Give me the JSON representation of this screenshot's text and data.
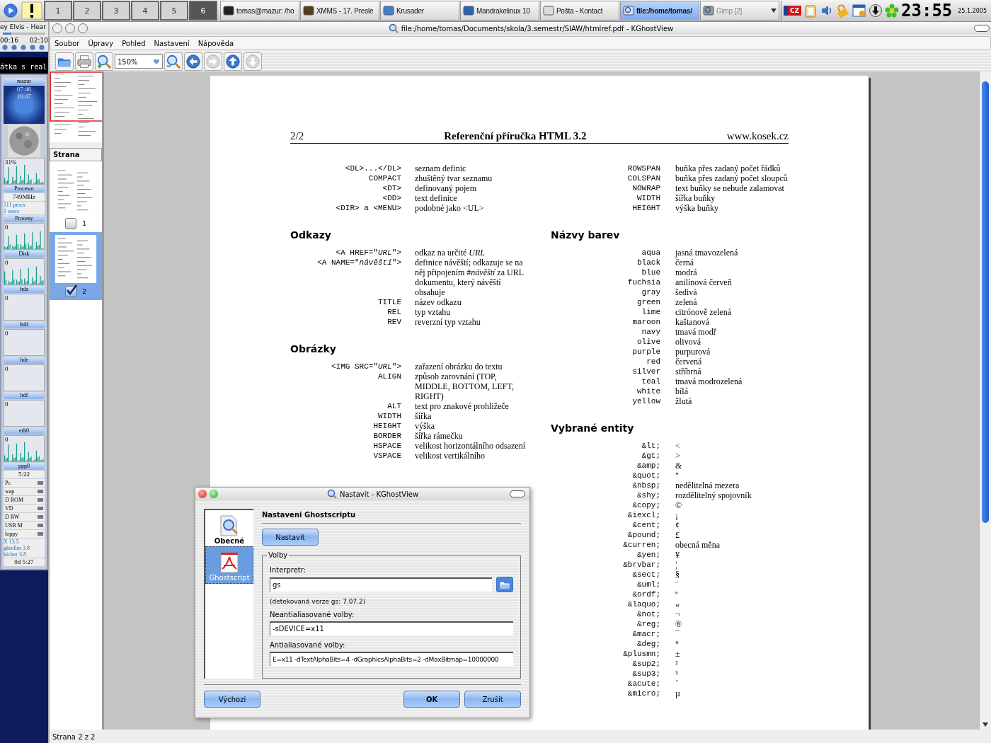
{
  "taskbar": {
    "pager": [
      {
        "label": "1",
        "selected": false
      },
      {
        "label": "2",
        "selected": false
      },
      {
        "label": "3",
        "selected": false
      },
      {
        "label": "4",
        "selected": false
      },
      {
        "label": "5",
        "selected": false
      },
      {
        "label": "6",
        "selected": true
      }
    ],
    "tasks": [
      {
        "label": "tomas@mazur: /ho",
        "active": false,
        "disabled": false
      },
      {
        "label": "XMMS - 17. Presle",
        "active": false,
        "disabled": false
      },
      {
        "label": "Krusader",
        "active": false,
        "disabled": false
      },
      {
        "label": "Mandrakelinux 10",
        "active": false,
        "disabled": false
      },
      {
        "label": "Pošta - Kontact",
        "active": false,
        "disabled": false
      },
      {
        "label": "file:/home/tomas/",
        "active": true,
        "disabled": false
      },
      {
        "label": "Gimp [2]",
        "active": false,
        "disabled": true
      }
    ],
    "keyboard_layout": "CZ",
    "clock": {
      "time": "23:55",
      "date": "25.1.2005"
    }
  },
  "gkrellm": {
    "player": {
      "ticker": "ey Elvis - Hear",
      "elapsed": "00:16",
      "total": "02:10",
      "level": 0.2
    },
    "scroller": "átka s real",
    "panels": [
      {
        "kind": "header",
        "text": "mazur"
      },
      {
        "kind": "sun",
        "times": [
          "07:46",
          "16:47"
        ]
      },
      {
        "kind": "moon"
      },
      {
        "kind": "graph",
        "value": "31%",
        "active": true
      },
      {
        "kind": "header",
        "text": "Procesor"
      },
      {
        "kind": "label",
        "text": "749MHz"
      },
      {
        "kind": "lines",
        "lines": [
          "111 procs",
          "1 users"
        ]
      },
      {
        "kind": "header",
        "text": "Procesy"
      },
      {
        "kind": "graph",
        "value": "0",
        "active": true
      },
      {
        "kind": "header",
        "text": "Disk"
      },
      {
        "kind": "graph",
        "value": "0",
        "active": true
      },
      {
        "kind": "header",
        "text": "hda"
      },
      {
        "kind": "graph",
        "value": "0",
        "active": false
      },
      {
        "kind": "header",
        "text": "hdd"
      },
      {
        "kind": "graph",
        "value": "0",
        "active": false
      },
      {
        "kind": "header",
        "text": "hde"
      },
      {
        "kind": "graph",
        "value": "0",
        "active": false
      },
      {
        "kind": "header",
        "text": "hdf"
      },
      {
        "kind": "graph",
        "value": "0",
        "active": false
      },
      {
        "kind": "header",
        "text": "eth0"
      },
      {
        "kind": "graph",
        "value": "0",
        "active": true
      },
      {
        "kind": "header",
        "text": "ppp0"
      },
      {
        "kind": "label",
        "text": "5:22"
      },
      {
        "kind": "meter",
        "text": "Pc"
      },
      {
        "kind": "meter",
        "text": "wap"
      },
      {
        "kind": "meter",
        "text": "D ROM"
      },
      {
        "kind": "meter",
        "text": "VD"
      },
      {
        "kind": "meter",
        "text": "D RW"
      },
      {
        "kind": "meter",
        "text": "USB M"
      },
      {
        "kind": "meter",
        "text": "loppy"
      },
      {
        "kind": "lines",
        "lines": [
          "X 13.5",
          "gkrellm 3.8",
          "kicker 3.8"
        ]
      },
      {
        "kind": "label",
        "text": "0d 5:27"
      }
    ]
  },
  "window": {
    "title": "file:/home/tomas/Documents/skola/3.semestr/SIAW/htmlref.pdf - KGhostView",
    "menu": [
      "Soubor",
      "Úpravy",
      "Pohled",
      "Nastavení",
      "Nápověda"
    ],
    "toolbar": [
      {
        "kind": "open"
      },
      {
        "kind": "print"
      },
      {
        "kind": "zoom-in"
      },
      {
        "kind": "zoom",
        "value": "150%"
      },
      {
        "kind": "zoom-out"
      },
      {
        "kind": "back",
        "disabled": false
      },
      {
        "kind": "forward",
        "disabled": true
      },
      {
        "kind": "up",
        "disabled": false
      },
      {
        "kind": "down",
        "disabled": true
      }
    ],
    "navigator": {
      "header": "Strana",
      "pages": [
        {
          "label": "1",
          "checked": false,
          "selected": false
        },
        {
          "label": "2",
          "checked": true,
          "selected": true
        }
      ]
    },
    "document": {
      "page_number": "2/2",
      "title": "Referenční příručka HTML 3.2",
      "site": "www.kosek.cz",
      "columns": [
        [
          {
            "rows": [
              {
                "key": "<DL>...</DL>",
                "desc": "seznam definic"
              },
              {
                "key": "COMPACT",
                "desc": "zhuštěný tvar seznamu"
              },
              {
                "key": "<DT>",
                "desc": "definovaný pojem"
              },
              {
                "key": "<DD>",
                "desc": "text definice"
              },
              {
                "key": "<DIR> a <MENU>",
                "desc": "podobné jako <UL>"
              }
            ]
          },
          {
            "heading": "Odkazy",
            "rows": [
              {
                "key": "<A HREF=\"*URL*\">",
                "desc": "odkaz na určité *URL*"
              },
              {
                "key": "<A NAME=\"*návěští*\">",
                "desc": "definice návěští; odkazuje se na něj připojením #*návěští* za URL dokumentu, který návěští obsahuje"
              },
              {
                "key": "TITLE",
                "desc": "název odkazu"
              },
              {
                "key": "REL",
                "desc": "typ vztahu"
              },
              {
                "key": "REV",
                "desc": "reverzní typ vztahu"
              }
            ]
          },
          {
            "heading": "Obrázky",
            "rows": [
              {
                "key": "<IMG SRC=\"*URL*\">",
                "desc": "zařazení obrázku do textu"
              },
              {
                "key": "ALIGN",
                "desc": "způsob zarovnání (TOP, MIDDLE, BOTTOM, LEFT, RIGHT)"
              },
              {
                "key": "ALT",
                "desc": "text pro znakové prohlížeče"
              },
              {
                "key": "WIDTH",
                "desc": "šířka"
              },
              {
                "key": "HEIGHT",
                "desc": "výška"
              },
              {
                "key": "BORDER",
                "desc": "šířka rámečku"
              },
              {
                "key": "HSPACE",
                "desc": "velikost horizontálního odsazení"
              },
              {
                "key": "VSPACE",
                "desc": "velikost vertikálního"
              }
            ]
          }
        ],
        [
          {
            "rows": [
              {
                "key": "ROWSPAN",
                "desc": "buňka přes zadaný počet řádků"
              },
              {
                "key": "COLSPAN",
                "desc": "buňka přes zadaný počet sloupců"
              },
              {
                "key": "NOWRAP",
                "desc": "text buňky se nebude zalamovat"
              },
              {
                "key": "WIDTH",
                "desc": "šířka buňky"
              },
              {
                "key": "HEIGHT",
                "desc": "výška buňky"
              }
            ]
          },
          {
            "heading": "Názvy barev",
            "rows": [
              {
                "key": "aqua",
                "desc": "jasná tmavozelená"
              },
              {
                "key": "black",
                "desc": "černá"
              },
              {
                "key": "blue",
                "desc": "modrá"
              },
              {
                "key": "fuchsia",
                "desc": "anilínová červeň"
              },
              {
                "key": "gray",
                "desc": "šedivá"
              },
              {
                "key": "green",
                "desc": "zelená"
              },
              {
                "key": "lime",
                "desc": "citrónově zelená"
              },
              {
                "key": "maroon",
                "desc": "kaštanová"
              },
              {
                "key": "navy",
                "desc": "tmavá modř"
              },
              {
                "key": "olive",
                "desc": "olivová"
              },
              {
                "key": "purple",
                "desc": "purpurová"
              },
              {
                "key": "red",
                "desc": "červená"
              },
              {
                "key": "silver",
                "desc": "stříbrná"
              },
              {
                "key": "teal",
                "desc": "tmavá modrozelená"
              },
              {
                "key": "white",
                "desc": "bílá"
              },
              {
                "key": "yellow",
                "desc": "žlutá"
              }
            ]
          },
          {
            "heading": "Vybrané entity",
            "rows": [
              {
                "key": "&lt;",
                "desc": "<"
              },
              {
                "key": "&gt;",
                "desc": ">"
              },
              {
                "key": "&amp;",
                "desc": "&"
              },
              {
                "key": "&quot;",
                "desc": "\""
              },
              {
                "key": "&nbsp;",
                "desc": "nedělitelná mezera"
              },
              {
                "key": "&shy;",
                "desc": "rozdělitelný spojovník"
              },
              {
                "key": "&copy;",
                "desc": "©"
              },
              {
                "key": "&iexcl;",
                "desc": "¡"
              },
              {
                "key": "&cent;",
                "desc": "¢"
              },
              {
                "key": "&pound;",
                "desc": "£"
              },
              {
                "key": "&curren;",
                "desc": "obecná měna"
              },
              {
                "key": "&yen;",
                "desc": "¥"
              },
              {
                "key": "&brvbar;",
                "desc": "¦"
              },
              {
                "key": "&sect;",
                "desc": "§"
              },
              {
                "key": "&uml;",
                "desc": "¨"
              },
              {
                "key": "&ordf;",
                "desc": "ª"
              },
              {
                "key": "&laquo;",
                "desc": "«"
              },
              {
                "key": "&not;",
                "desc": "¬"
              },
              {
                "key": "&reg;",
                "desc": "®"
              },
              {
                "key": "&macr;",
                "desc": "¯"
              },
              {
                "key": "&deg;",
                "desc": "°"
              },
              {
                "key": "&plusmn;",
                "desc": "±"
              },
              {
                "key": "&sup2;",
                "desc": "²"
              },
              {
                "key": "&sup3;",
                "desc": "³"
              },
              {
                "key": "&acute;",
                "desc": "´"
              },
              {
                "key": "&micro;",
                "desc": "µ"
              }
            ]
          }
        ]
      ]
    },
    "status_bar": "Strana 2 z 2"
  },
  "dialog": {
    "title": "Nastavit - KGhostView",
    "sections": [
      {
        "label": "Obecné",
        "selected": false
      },
      {
        "label": "Ghostscript",
        "selected": true
      }
    ],
    "heading": "Nastaveni Ghostscriptu",
    "configure_button": "Nastavit",
    "group": "Volby",
    "interpreter_label": "Interpretr:",
    "interpreter": "gs",
    "detected": "(detekovaná verze gs: 7.07.2)",
    "non_aa_label": "Neantialiasované volby:",
    "non_aa": "-sDEVICE=x11",
    "aa_label": "Antialiasované volby:",
    "aa": "E=x11 -dTextAlphaBits=4 -dGraphicsAlphaBits=2 -dMaxBitmap=10000000",
    "buttons": [
      "Výchozi",
      "OK",
      "Zrušit"
    ]
  }
}
